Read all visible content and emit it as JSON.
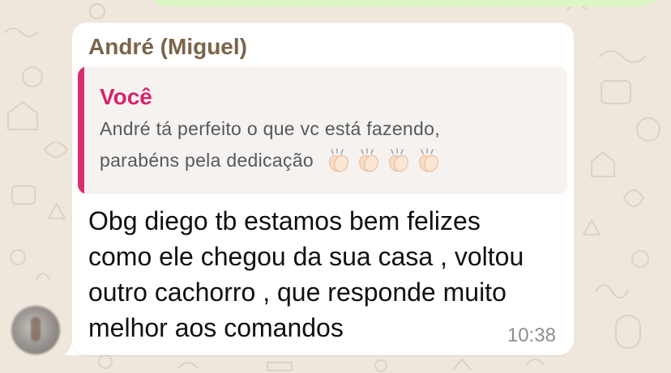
{
  "message": {
    "sender_name": "André (Miguel)",
    "reply": {
      "author": "Você",
      "line1": "André tá perfeito o que vc está fazendo,",
      "line2": "parabéns pela dedicação",
      "emoji_icons": [
        "clapping-hands-icon",
        "clapping-hands-icon",
        "clapping-hands-icon",
        "clapping-hands-icon"
      ]
    },
    "text_lines": [
      "Obg diego tb estamos bem felizes",
      "como ele chegou da sua casa , voltou",
      "outro cachorro , que responde muito",
      "melhor aos comandos"
    ],
    "time": "10:38"
  },
  "colors": {
    "chat_background": "#efe7dc",
    "bubble": "#ffffff",
    "outgoing_bubble": "#dcf7c5",
    "sender_name": "#7a6449",
    "quote_bar": "#da2d6e",
    "quote_author": "#d7236a",
    "quote_background": "#f5f2f0",
    "timestamp": "#8a8d91"
  }
}
